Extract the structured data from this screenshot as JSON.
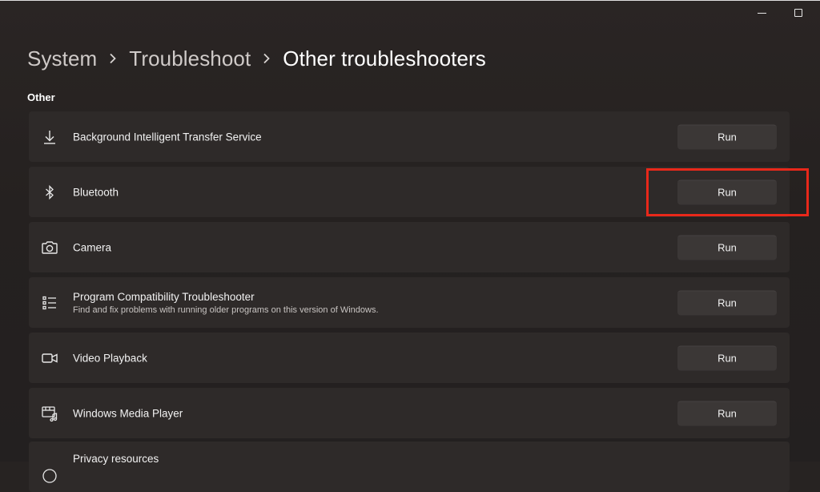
{
  "window": {
    "minimize_icon": "minimize-icon",
    "maximize_icon": "maximize-icon"
  },
  "breadcrumb": {
    "items": [
      "System",
      "Troubleshoot",
      "Other troubleshooters"
    ],
    "separator_icon": "chevron-right-icon"
  },
  "section": {
    "title": "Other"
  },
  "troubleshooters": [
    {
      "icon": "download-icon",
      "title": "Background Intelligent Transfer Service",
      "button": "Run"
    },
    {
      "icon": "bluetooth-icon",
      "title": "Bluetooth",
      "button": "Run"
    },
    {
      "icon": "camera-icon",
      "title": "Camera",
      "button": "Run"
    },
    {
      "icon": "list-icon",
      "title": "Program Compatibility Troubleshooter",
      "description": "Find and fix problems with running older programs on this version of Windows.",
      "button": "Run"
    },
    {
      "icon": "video-icon",
      "title": "Video Playback",
      "button": "Run"
    },
    {
      "icon": "media-player-icon",
      "title": "Windows Media Player",
      "button": "Run"
    },
    {
      "icon": "globe-icon",
      "title": "Privacy resources"
    }
  ],
  "colors": {
    "background": "#272322",
    "card": "#2e2a29",
    "button": "#3b3736",
    "highlight": "#e8281a"
  }
}
